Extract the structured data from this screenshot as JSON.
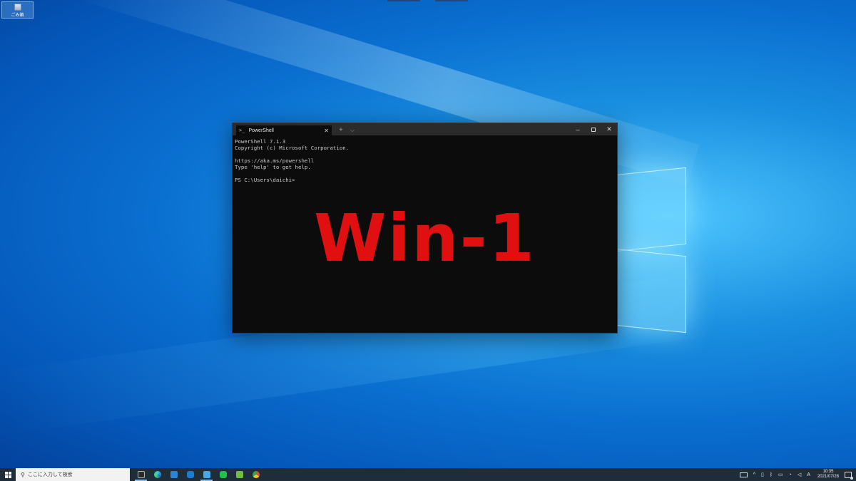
{
  "desktop": {
    "icon_label": "ごみ箱"
  },
  "terminal": {
    "tab_title": "PowerShell",
    "tab_icon": "powershell-icon",
    "lines": [
      "PowerShell 7.1.3",
      "Copyright (c) Microsoft Corporation.",
      "",
      "https://aka.ms/powershell",
      "Type 'help' to get help.",
      "",
      "PS C:\\Users\\daichi>"
    ],
    "overlay_label": "Win-1",
    "overlay_color": "#e01010"
  },
  "taskbar": {
    "search_placeholder": "ここに入力して検索",
    "pinned_apps": [
      "windows-terminal-icon",
      "edge-icon",
      "mail-icon",
      "app-icon",
      "store-icon",
      "line-icon",
      "green-app-icon",
      "chrome-icon"
    ],
    "ime_indicator": "A",
    "clock_time": "10:35",
    "clock_date": "2021/07/28"
  }
}
